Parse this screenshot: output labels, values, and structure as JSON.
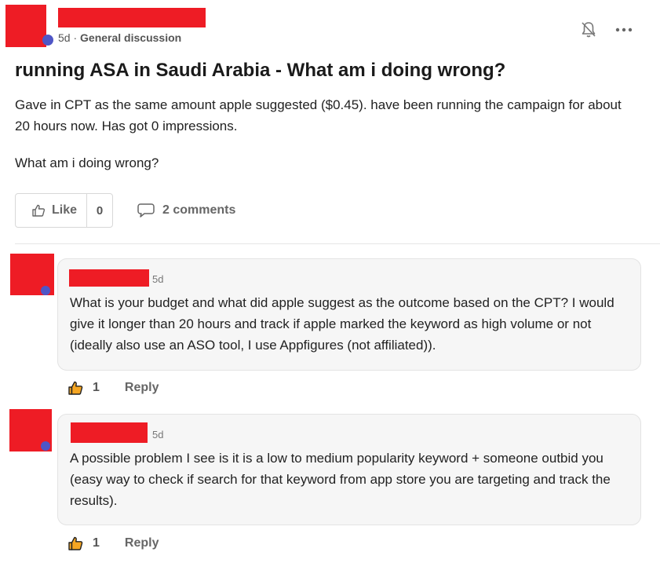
{
  "post": {
    "time": "5d",
    "separator": "·",
    "category": "General discussion",
    "title": "running ASA in Saudi Arabia - What am i doing wrong?",
    "paragraphs": [
      "Gave in CPT as the same amount apple suggested ($0.45). have been running the campaign for about 20 hours now. Has got 0 impressions.",
      "What am i doing wrong?"
    ],
    "like_label": "Like",
    "like_count": "0",
    "comments_label": "2 comments"
  },
  "comments": [
    {
      "time": "5d",
      "text": "What is your budget and what did apple suggest as the outcome based on the CPT? I would give it longer than 20 hours and track if apple marked the keyword as high volume or not (ideally also use an ASO tool, I use Appfigures (not affiliated)).",
      "likes": "1",
      "reply_label": "Reply"
    },
    {
      "time": "5d",
      "text": "A possible problem I see is it is a low to medium popularity keyword + someone outbid you (easy way to check if search for that keyword from app store you are targeting and track the results).",
      "likes": "1",
      "reply_label": "Reply"
    }
  ],
  "colors": {
    "redaction": "#ee1c25",
    "like_icon_fill": "#f5a623",
    "avatar_badge": "#4f56c6"
  }
}
